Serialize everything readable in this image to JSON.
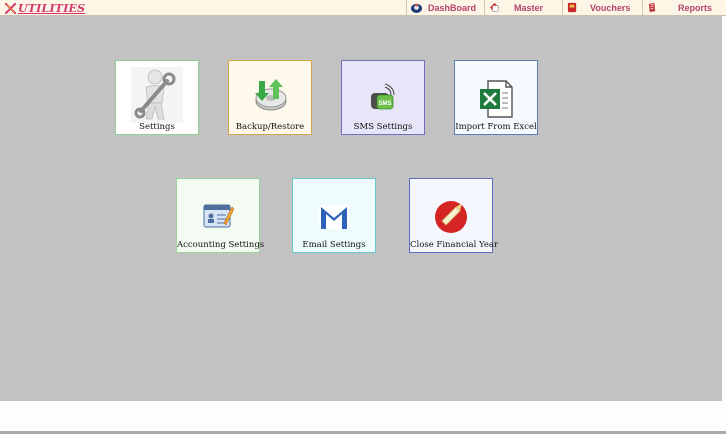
{
  "header": {
    "title": "UTILITIES",
    "nav": [
      {
        "label": "DashBoard",
        "icon": "dashboard-icon"
      },
      {
        "label": "Master",
        "icon": "master-icon"
      },
      {
        "label": "Vouchers",
        "icon": "vouchers-icon"
      },
      {
        "label": "Reports",
        "icon": "reports-icon"
      }
    ]
  },
  "tiles": [
    {
      "label": "Settings",
      "icon": "wrench-person-icon"
    },
    {
      "label": "Backup/Restore",
      "icon": "backup-restore-icon"
    },
    {
      "label": "SMS Settings",
      "icon": "sms-icon"
    },
    {
      "label": "Import From Excel",
      "icon": "excel-icon"
    },
    {
      "label": "Accounting Settings",
      "icon": "accounting-card-icon"
    },
    {
      "label": "Email Settings",
      "icon": "email-icon"
    },
    {
      "label": "Close Financial Year",
      "icon": "close-year-icon"
    }
  ],
  "colors": {
    "title": "#d2386e",
    "nav_text": "#b4436a",
    "workspace": "#c2c2c2",
    "topbar": "#fdf6e7"
  }
}
